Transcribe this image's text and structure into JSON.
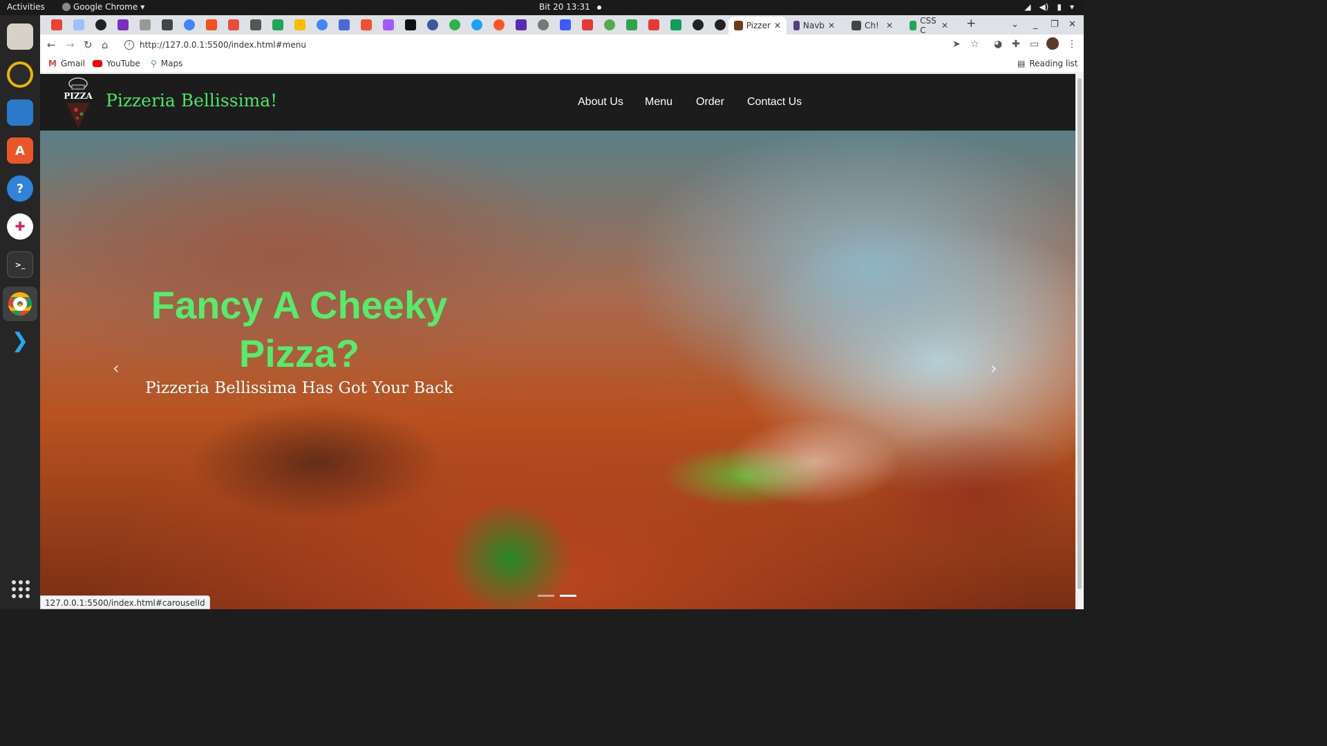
{
  "system": {
    "activities": "Activities",
    "app_name": "Google Chrome",
    "clock": "Bit 20  13:31"
  },
  "dock": {
    "items": [
      "files",
      "rhythmbox",
      "writer",
      "software",
      "help",
      "slack",
      "terminal",
      "chrome",
      "vscode"
    ]
  },
  "browser": {
    "tabs": [
      {
        "label": "Pizzer",
        "active": true
      },
      {
        "label": "Navb"
      },
      {
        "label": "Ch!"
      },
      {
        "label": "CSS C"
      }
    ],
    "url": "http://127.0.0.1:5500/index.html#menu",
    "bookmarks": [
      "Gmail",
      "YouTube",
      "Maps"
    ],
    "reading_list": "Reading list",
    "status_url": "127.0.0.1:5500/index.html#carouselId"
  },
  "site": {
    "brand": "Pizzeria Bellissima!",
    "logo_text": "PIZZA",
    "nav": [
      "About Us",
      "Menu",
      "Order",
      "Contact Us"
    ],
    "hero": {
      "title": "Fancy A Cheeky Pizza?",
      "subtitle": "Pizzeria Bellissima Has Got Your Back"
    }
  },
  "colors": {
    "brand_green": "#4ee36b",
    "nav_bg": "#1c1c1c"
  }
}
